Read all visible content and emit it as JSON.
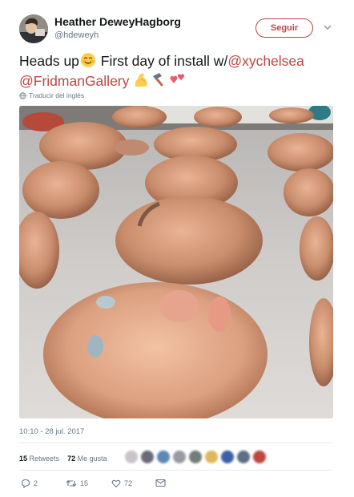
{
  "user": {
    "display_name": "Heather DeweyHagborg",
    "handle": "@hdeweyh"
  },
  "follow_button_label": "Seguir",
  "tweet": {
    "text_start": "Heads up",
    "text_mid": " First day of install w/",
    "mention1": "@xychelsea",
    "mention2": "@FridmanGallery",
    "emojis": [
      "smiling-face-emoji",
      "flexed-biceps-emoji",
      "hammer-emoji",
      "two-hearts-emoji"
    ],
    "translate_label": "Traducir del inglés"
  },
  "timestamp": "10:10 - 28 jul. 2017",
  "stats": {
    "retweets_count": "15",
    "retweets_label": "Retweets",
    "likes_count": "72",
    "likes_label": "Me gusta"
  },
  "actions": {
    "reply_count": "2",
    "retweet_count": "15",
    "like_count": "72"
  },
  "colors": {
    "accent": "#bf4543",
    "text": "#14171a",
    "secondary": "#657786",
    "divider": "#e6ecf0"
  }
}
